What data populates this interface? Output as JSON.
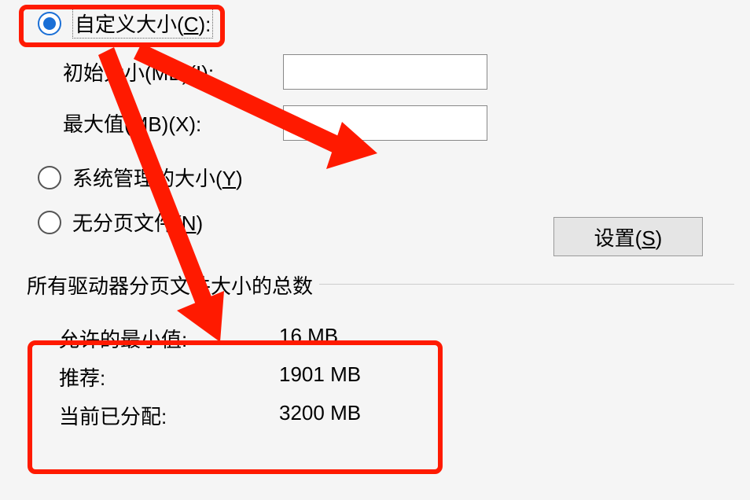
{
  "options": {
    "custom_size": {
      "text": "自定义大小",
      "accel": "C"
    },
    "initial_size": {
      "text": "初始大小(MB)",
      "accel": "I"
    },
    "max_size": {
      "text": "最大值(MB)",
      "accel": "X"
    },
    "system_managed": {
      "text": "系统管理的大小",
      "accel": "Y"
    },
    "no_paging": {
      "text": "无分页文件",
      "accel": "N"
    }
  },
  "inputs": {
    "initial_value": "",
    "max_value": ""
  },
  "button": {
    "set_text": "设置",
    "set_accel": "S"
  },
  "group": {
    "title": "所有驱动器分页文件大小的总数",
    "min_allowed_label": "允许的最小值:",
    "min_allowed_value": "16 MB",
    "recommended_label": "推荐:",
    "recommended_value": "1901 MB",
    "current_label": "当前已分配:",
    "current_value": "3200 MB"
  }
}
